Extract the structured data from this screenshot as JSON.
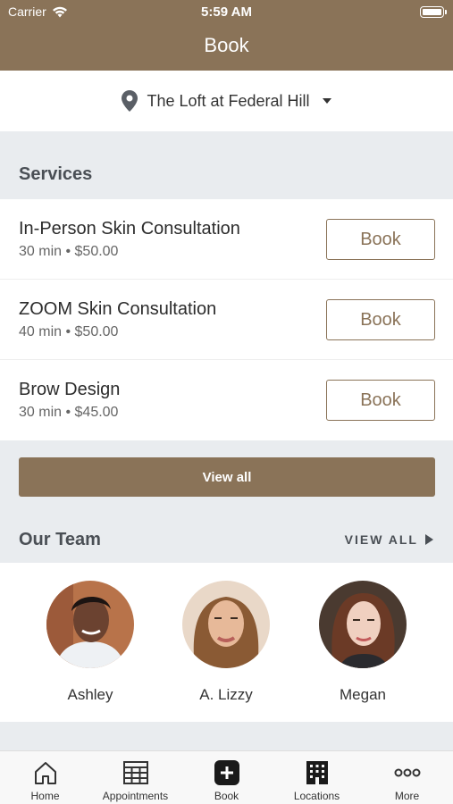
{
  "status_bar": {
    "carrier": "Carrier",
    "time": "5:59 AM"
  },
  "nav": {
    "title": "Book"
  },
  "location": {
    "name": "The Loft at Federal Hill"
  },
  "services": {
    "title": "Services",
    "items": [
      {
        "name": "In-Person Skin Consultation",
        "meta": "30 min • $50.00",
        "button": "Book"
      },
      {
        "name": "ZOOM Skin Consultation",
        "meta": "40 min • $50.00",
        "button": "Book"
      },
      {
        "name": "Brow Design",
        "meta": "30 min • $45.00",
        "button": "Book"
      }
    ],
    "view_all": "View all"
  },
  "team": {
    "title": "Our Team",
    "view_all": "VIEW ALL",
    "members": [
      {
        "name": "Ashley"
      },
      {
        "name": "A. Lizzy"
      },
      {
        "name": "Megan"
      }
    ]
  },
  "tabs": [
    {
      "label": "Home",
      "icon": "home-icon"
    },
    {
      "label": "Appointments",
      "icon": "calendar-grid-icon"
    },
    {
      "label": "Book",
      "icon": "plus-icon"
    },
    {
      "label": "Locations",
      "icon": "building-icon"
    },
    {
      "label": "More",
      "icon": "more-icon"
    }
  ],
  "colors": {
    "brand": "#8a7358",
    "background": "#e9ecef",
    "text_dark": "#4a4f55"
  }
}
